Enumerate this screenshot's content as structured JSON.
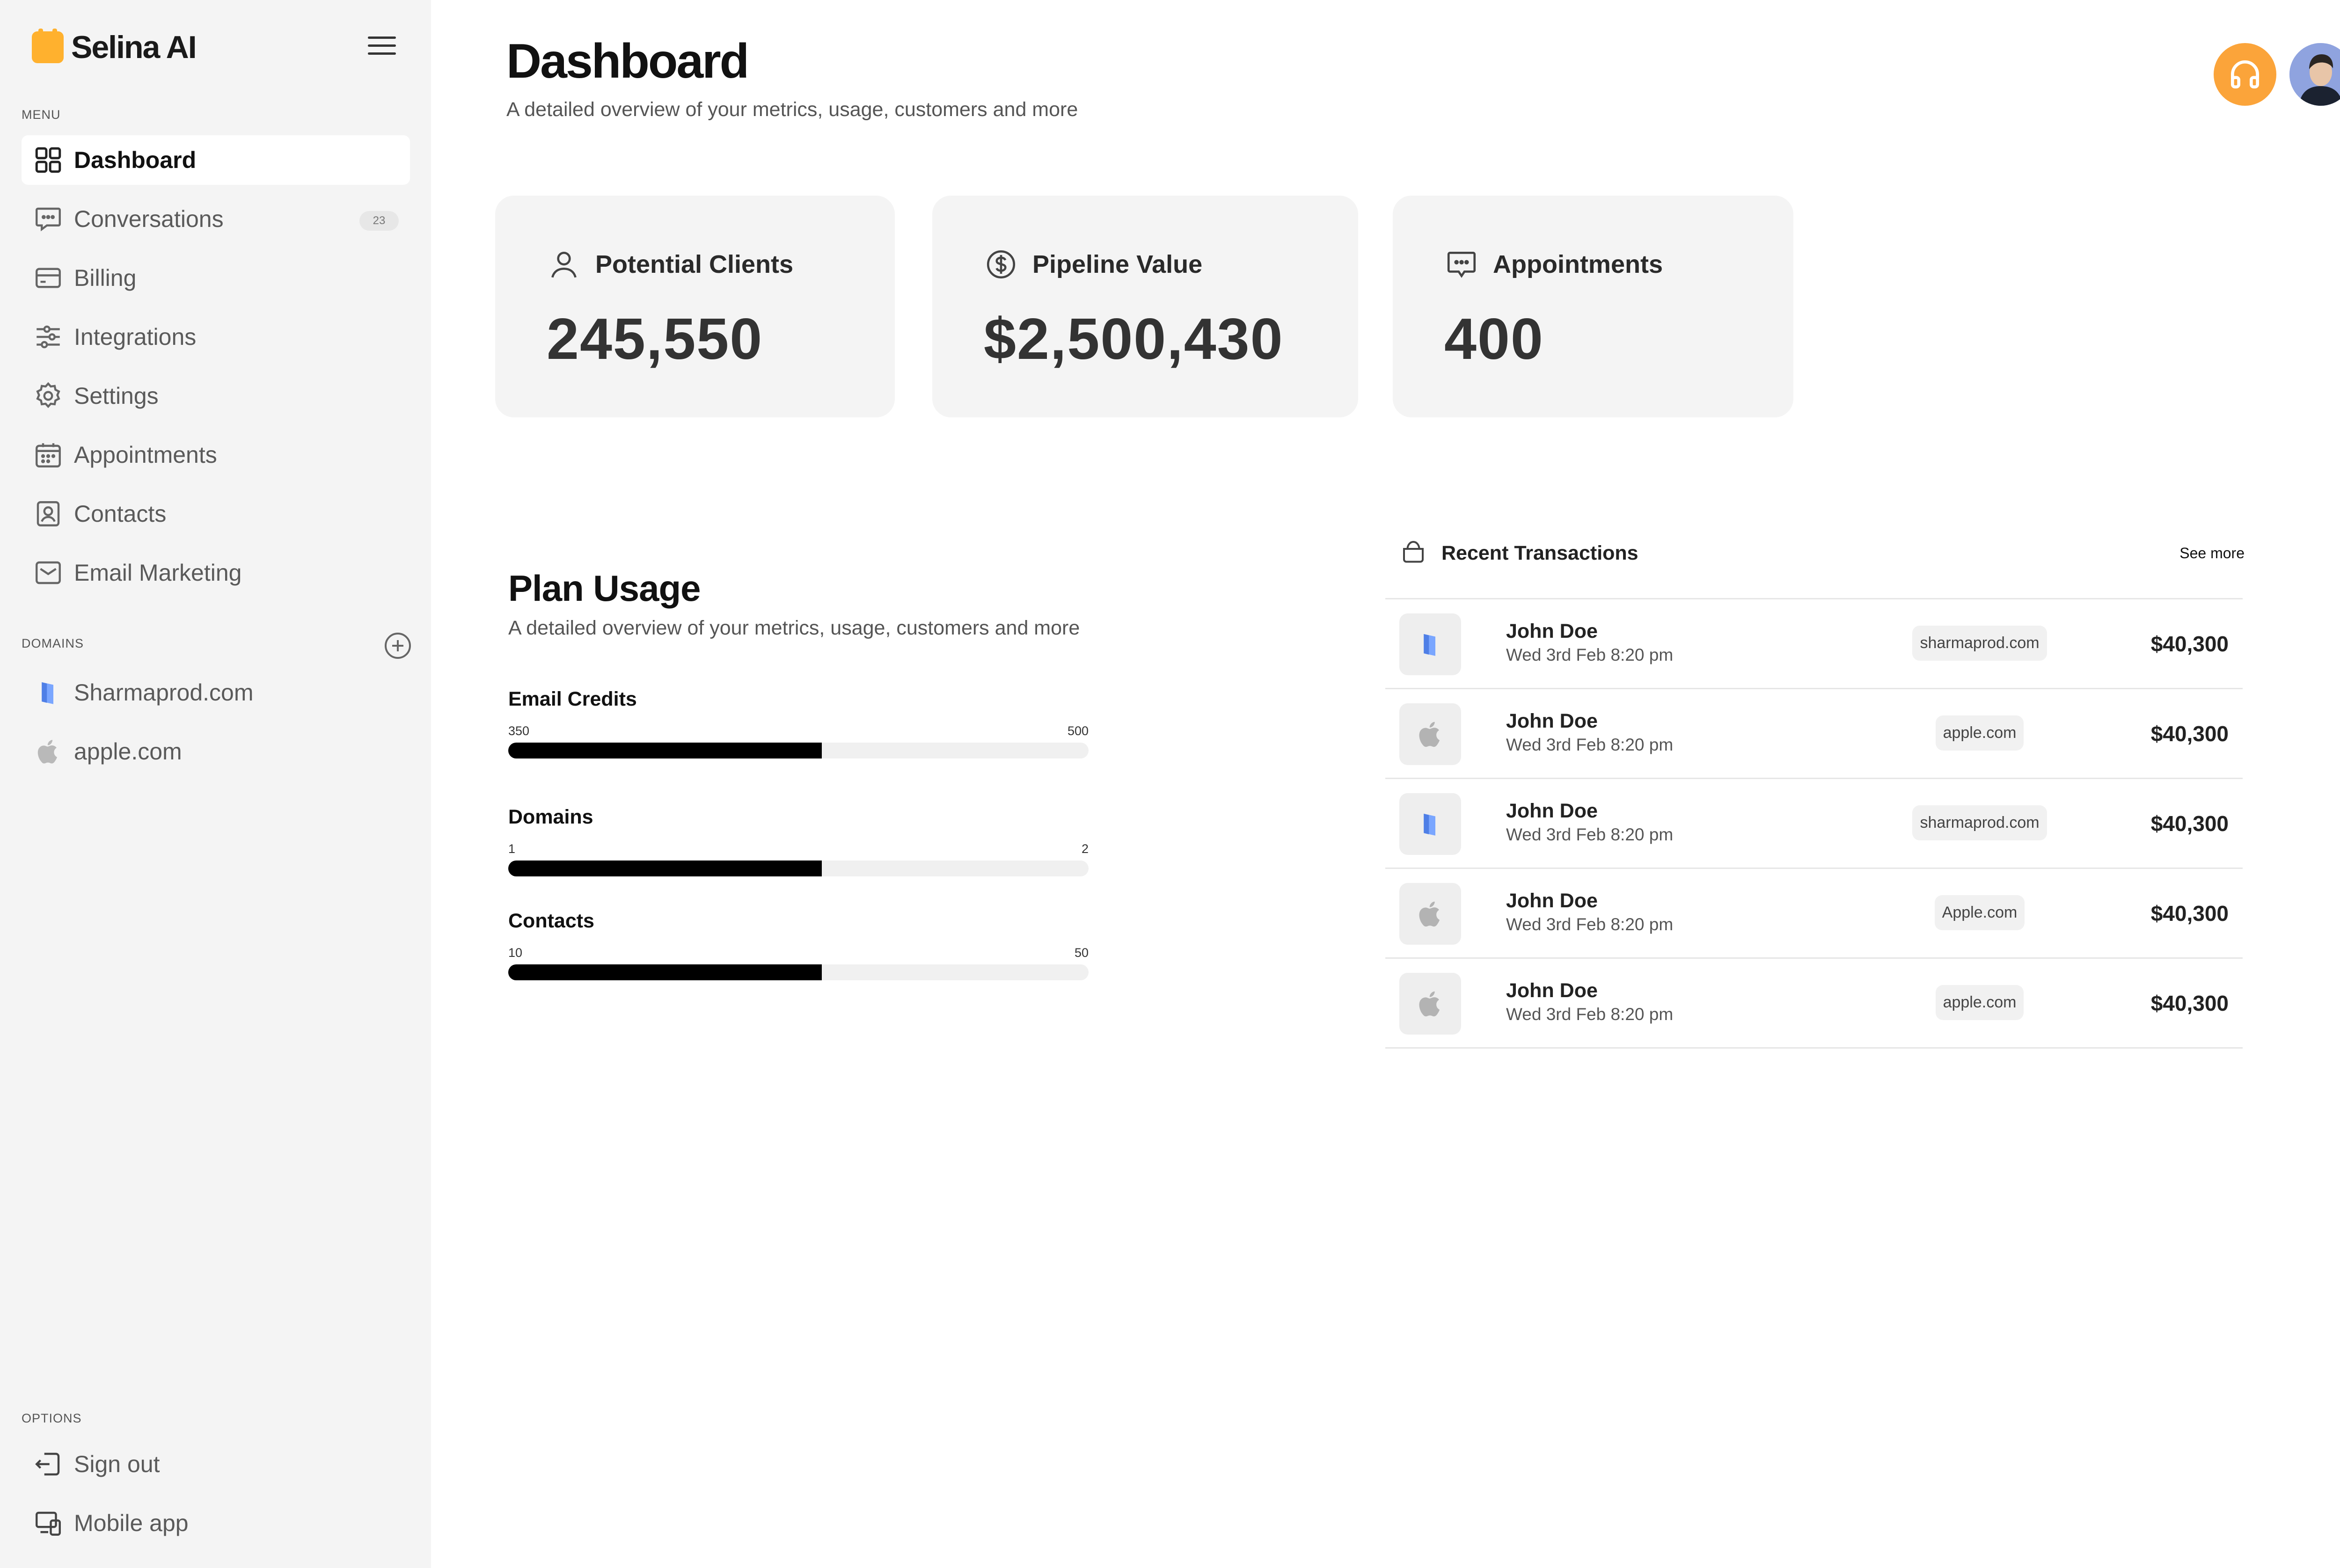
{
  "brand": {
    "name": "Selina AI"
  },
  "sidebar": {
    "menu_label": "MENU",
    "items": [
      {
        "label": "Dashboard",
        "icon": "dashboard-grid-icon",
        "active": true
      },
      {
        "label": "Conversations",
        "icon": "chat-bubble-icon",
        "badge": "23"
      },
      {
        "label": "Billing",
        "icon": "credit-card-icon"
      },
      {
        "label": "Integrations",
        "icon": "sliders-icon"
      },
      {
        "label": "Settings",
        "icon": "gear-icon"
      },
      {
        "label": "Appointments",
        "icon": "calendar-icon"
      },
      {
        "label": "Contacts",
        "icon": "contact-card-icon"
      },
      {
        "label": "Email Marketing",
        "icon": "mail-icon"
      }
    ],
    "domains_label": "DOMAINS",
    "domains": [
      {
        "label": "Sharmaprod.com",
        "icon": "sharmaprod-logo-icon"
      },
      {
        "label": "apple.com",
        "icon": "apple-logo-icon"
      }
    ],
    "options_label": "OPTIONS",
    "options": [
      {
        "label": "Sign out",
        "icon": "sign-out-icon"
      },
      {
        "label": "Mobile app",
        "icon": "devices-icon"
      }
    ]
  },
  "header": {
    "title": "Dashboard",
    "subtitle": "A detailed overview of your metrics, usage, customers and more",
    "accent_color": "#fba43a"
  },
  "stats": [
    {
      "label": "Potential Clients",
      "value": "245,550",
      "icon": "user-icon"
    },
    {
      "label": "Pipeline Value",
      "value": "$2,500,430",
      "icon": "dollar-circle-icon"
    },
    {
      "label": "Appointments",
      "value": "400",
      "icon": "chat-bubble-icon"
    }
  ],
  "plan_usage": {
    "title": "Plan Usage",
    "subtitle": "A detailed overview of your metrics, usage, customers and more",
    "items": [
      {
        "label": "Email Credits",
        "min": "350",
        "max": "500",
        "fill": 0.54
      },
      {
        "label": "Domains",
        "min": "1",
        "max": "2",
        "fill": 0.54
      },
      {
        "label": "Contacts",
        "min": "10",
        "max": "50",
        "fill": 0.54
      }
    ]
  },
  "transactions": {
    "title": "Recent Transactions",
    "see_more": "See more",
    "rows": [
      {
        "name": "John Doe",
        "date": "Wed 3rd Feb 8:20 pm",
        "domain": "sharmaprod.com",
        "amount": "$40,300",
        "logo": "sharmaprod"
      },
      {
        "name": "John Doe",
        "date": "Wed 3rd Feb 8:20 pm",
        "domain": "apple.com",
        "amount": "$40,300",
        "logo": "apple"
      },
      {
        "name": "John Doe",
        "date": "Wed 3rd Feb 8:20 pm",
        "domain": "sharmaprod.com",
        "amount": "$40,300",
        "logo": "sharmaprod"
      },
      {
        "name": "John Doe",
        "date": "Wed 3rd Feb 8:20 pm",
        "domain": "Apple.com",
        "amount": "$40,300",
        "logo": "apple"
      },
      {
        "name": "John Doe",
        "date": "Wed 3rd Feb 8:20 pm",
        "domain": "apple.com",
        "amount": "$40,300",
        "logo": "apple"
      }
    ]
  }
}
